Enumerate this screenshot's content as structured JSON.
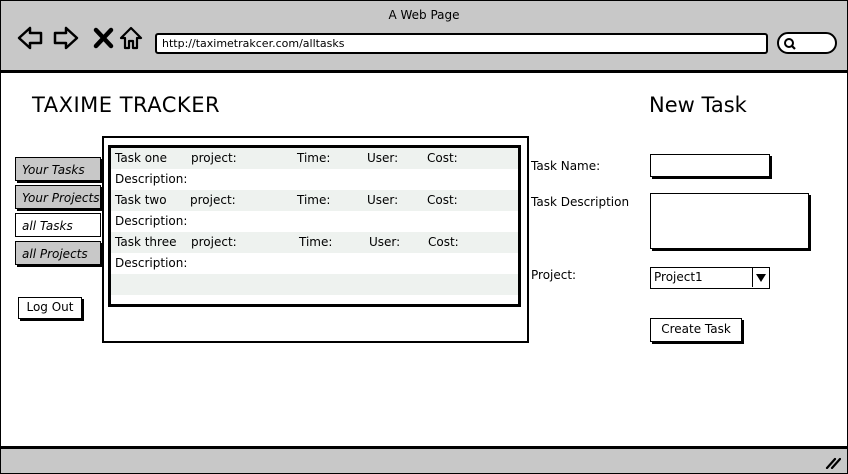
{
  "browser": {
    "title": "A Web Page",
    "url": "http://taximetrakcer.com/alltasks"
  },
  "app": {
    "title": "TAXIME TRACKER"
  },
  "sidebar": {
    "tabs": [
      {
        "label": "Your Tasks"
      },
      {
        "label": "Your Projects"
      },
      {
        "label": "all Tasks"
      },
      {
        "label": "all Projects"
      }
    ],
    "logout_label": "Log Out"
  },
  "task_list": {
    "rows": [
      {
        "kind": "main",
        "task": "Task one",
        "project": "project:",
        "time": "Time:",
        "user": "User:",
        "cost": "Cost:"
      },
      {
        "kind": "desc",
        "task": "Description:"
      },
      {
        "kind": "main",
        "task": "Task two",
        "project": "project:",
        "time": "Time:",
        "user": "User:",
        "cost": "Cost:"
      },
      {
        "kind": "desc",
        "task": "Description:"
      },
      {
        "kind": "main",
        "task": "Task three",
        "project": "project:",
        "time": "Time:",
        "user": "User:",
        "cost": "Cost:"
      },
      {
        "kind": "desc",
        "task": "Description:"
      }
    ]
  },
  "new_task": {
    "heading": "New Task",
    "name_label": "Task Name:",
    "name_value": "",
    "description_label": "Task Description",
    "description_value": "",
    "project_label": "Project:",
    "project_selected": "Project1",
    "create_label": "Create Task"
  }
}
